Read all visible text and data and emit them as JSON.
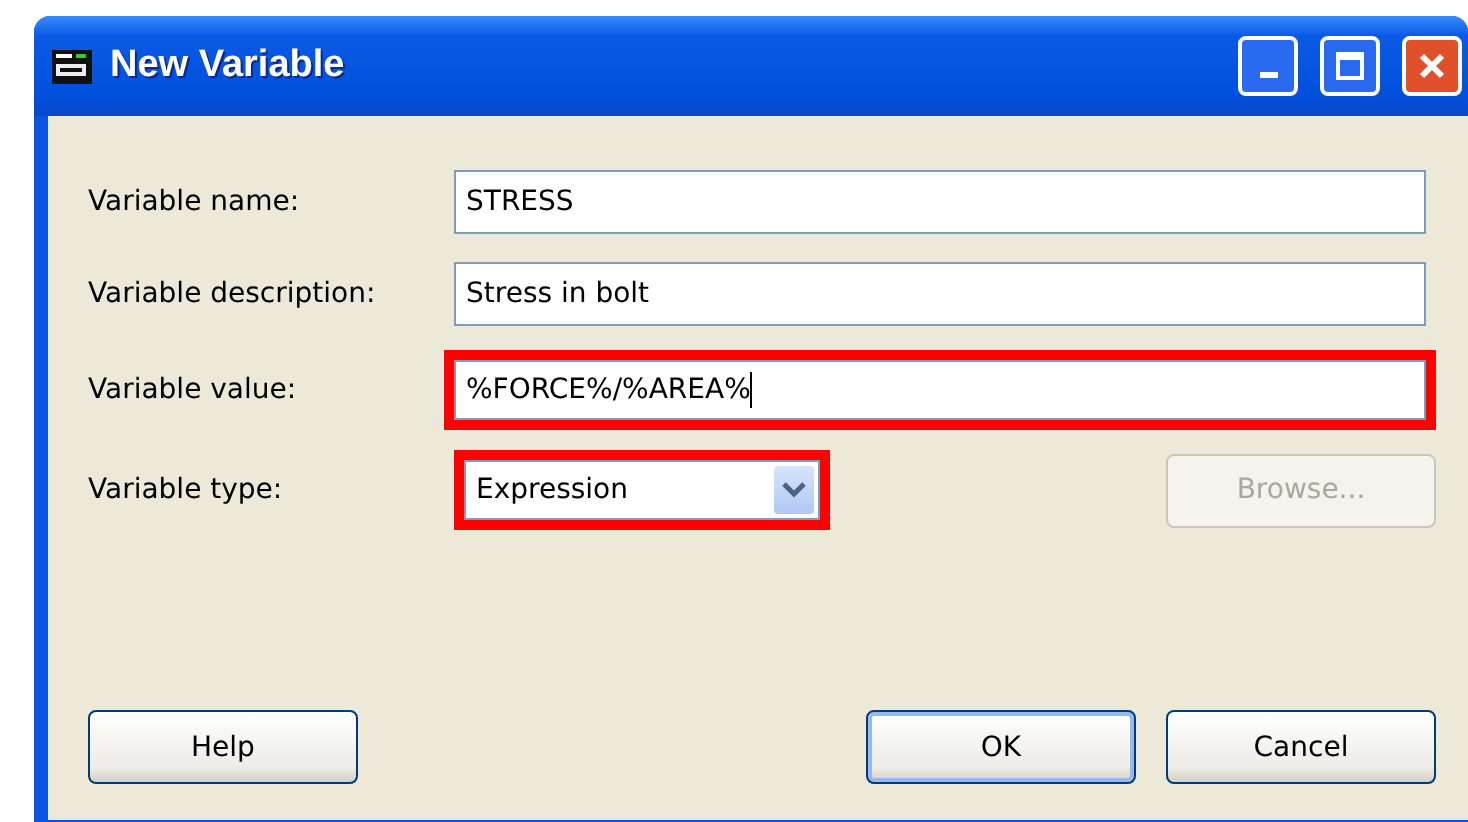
{
  "window": {
    "title": "New Variable"
  },
  "fields": [
    {
      "label": "Variable name:",
      "kind": "text",
      "value": "STRESS",
      "highlighted": false
    },
    {
      "label": "Variable description:",
      "kind": "text",
      "value": "Stress in bolt",
      "highlighted": false
    },
    {
      "label": "Variable value:",
      "kind": "text",
      "value": "%FORCE%/%AREA%",
      "highlighted": true,
      "focused": true
    },
    {
      "label": "Variable type:",
      "kind": "combo",
      "value": "Expression",
      "highlighted": true,
      "side_button": {
        "label": "Browse...",
        "disabled": true
      }
    }
  ],
  "buttons": [
    {
      "label": "Help",
      "default": false
    },
    {
      "label": "OK",
      "default": true
    },
    {
      "label": "Cancel",
      "default": false
    }
  ]
}
